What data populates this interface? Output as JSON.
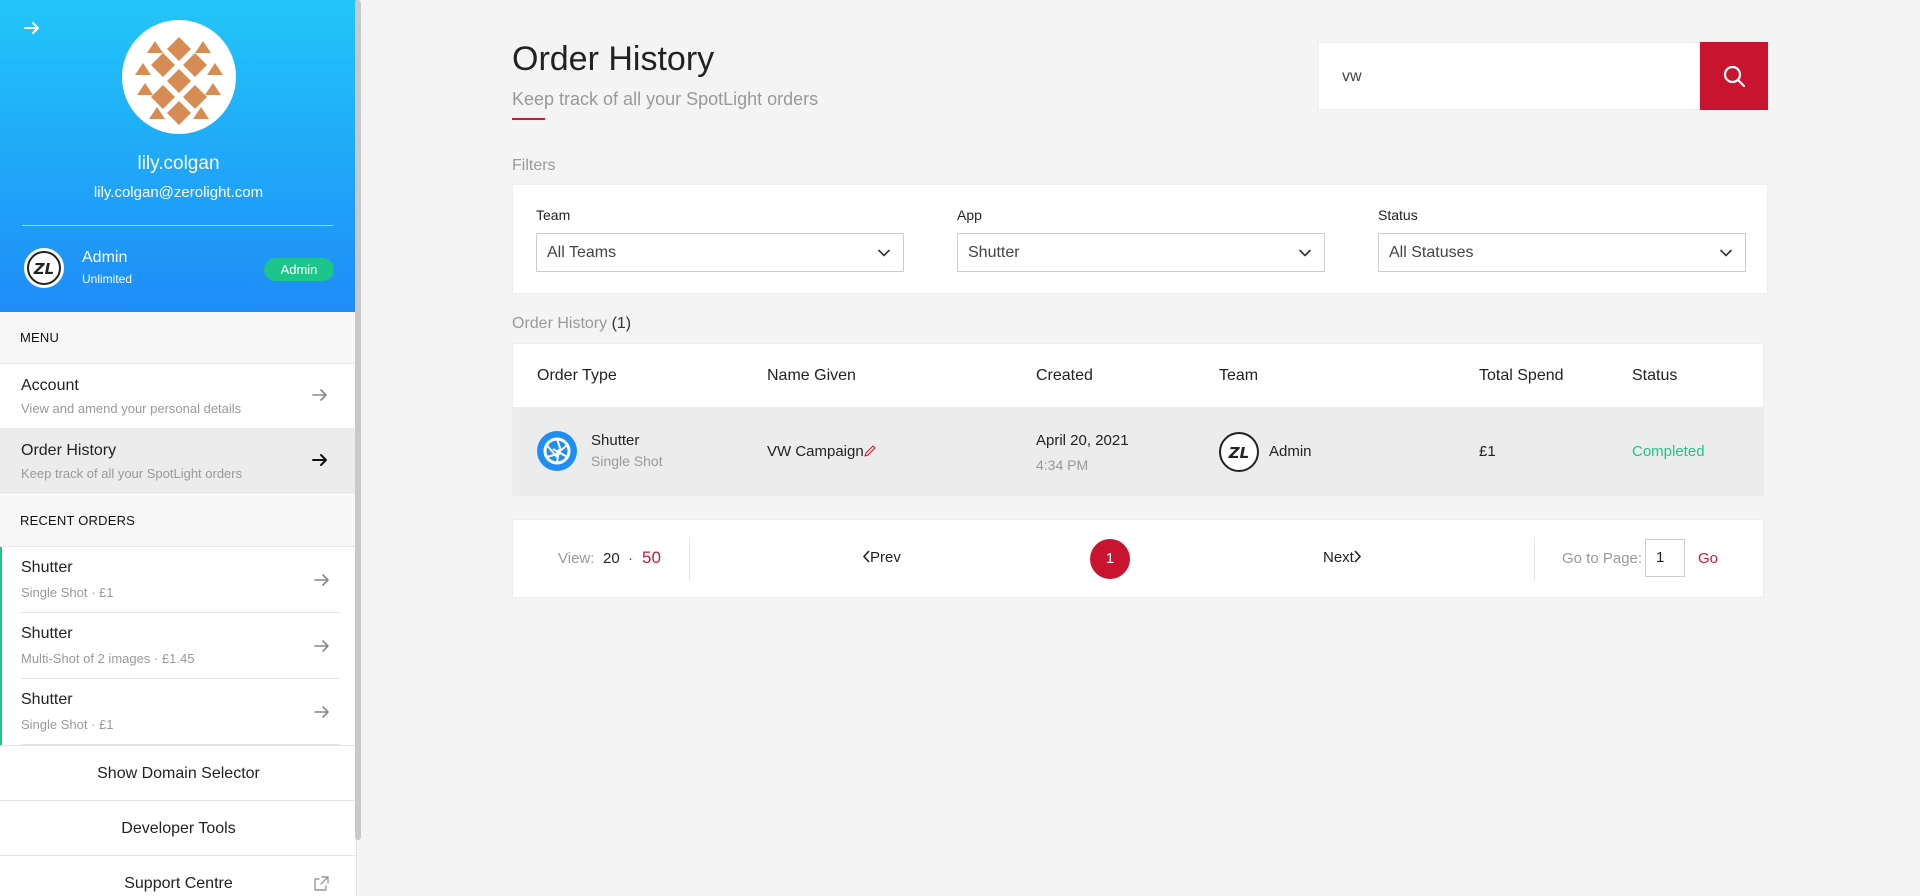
{
  "colors": {
    "accent": "#c8142e",
    "brand_blue": "#1e8cf8",
    "success": "#1dc48b"
  },
  "sidebar": {
    "profile": {
      "username": "lily.colgan",
      "email": "lily.colgan@zerolight.com"
    },
    "team": {
      "name": "Admin",
      "plan": "Unlimited",
      "badge": "Admin",
      "logo_text": "ZL"
    },
    "menu_header": "MENU",
    "menu": [
      {
        "title": "Account",
        "subtitle": "View and amend your personal details"
      },
      {
        "title": "Order History",
        "subtitle": "Keep track of all your SpotLight orders"
      }
    ],
    "recent_header": "RECENT ORDERS",
    "recent": [
      {
        "title": "Shutter",
        "subtitle": "Single Shot · £1"
      },
      {
        "title": "Shutter",
        "subtitle": "Multi-Shot of 2 images · £1.45"
      },
      {
        "title": "Shutter",
        "subtitle": "Single Shot · £1"
      }
    ],
    "buttons": {
      "domain": "Show Domain Selector",
      "dev": "Developer Tools",
      "support": "Support Centre"
    }
  },
  "main": {
    "title": "Order History",
    "subtitle": "Keep track of all your SpotLight orders",
    "search": {
      "value": "vw"
    },
    "filters_label": "Filters",
    "filters": [
      {
        "label": "Team",
        "value": "All Teams"
      },
      {
        "label": "App",
        "value": "Shutter"
      },
      {
        "label": "Status",
        "value": "All Statuses"
      }
    ],
    "order_history_label": "Order History",
    "order_count": "(1)",
    "table": {
      "headers": [
        "Order Type",
        "Name Given",
        "Created",
        "Team",
        "Total Spend",
        "Status"
      ],
      "rows": [
        {
          "order_type": "Shutter",
          "order_subtype": "Single Shot",
          "name_given": "VW Campaign",
          "created_date": "April 20, 2021",
          "created_time": "4:34 PM",
          "team": "Admin",
          "team_logo": "ZL",
          "total_spend": "£1",
          "status": "Completed"
        }
      ]
    },
    "pagination": {
      "view_label": "View:",
      "option_20": "20",
      "separator": "·",
      "option_50": "50",
      "prev": "Prev",
      "current_page": "1",
      "next": "Next",
      "goto_label": "Go to Page:",
      "goto_value": "1",
      "go": "Go"
    }
  }
}
